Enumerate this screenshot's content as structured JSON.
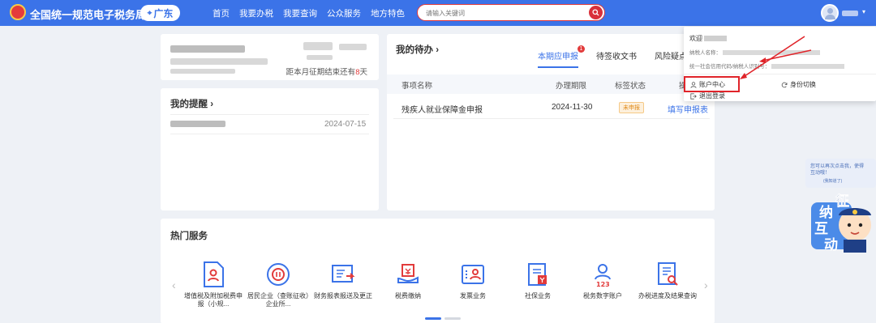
{
  "header": {
    "title": "全国统一规范电子税务局",
    "region": "广东",
    "nav": [
      "首页",
      "我要办税",
      "我要查询",
      "公众服务",
      "地方特色"
    ],
    "search_placeholder": "请输入关键词"
  },
  "profile": {
    "days_prefix": "距本月征期结束还有",
    "days": "8",
    "days_suffix": "天"
  },
  "reminders": {
    "title": "我的提醒",
    "items": [
      {
        "date": "2024-07-15"
      }
    ]
  },
  "todo": {
    "title": "我的待办",
    "tabs": [
      {
        "label": "本期应申报",
        "badge": "1"
      },
      {
        "label": "待签收文书"
      },
      {
        "label": "风险疑点"
      }
    ],
    "columns": [
      "事项名称",
      "办理期限",
      "标签状态",
      "操"
    ],
    "rows": [
      {
        "name": "残疾人就业保障金申报",
        "deadline": "2024-11-30",
        "status": "未申报",
        "action": "填写申报表"
      }
    ]
  },
  "hot": {
    "title": "热门服务",
    "services": [
      {
        "label": "增值税及附加税费申报（小规...",
        "icon": "document-user-icon"
      },
      {
        "label": "居民企业（查账征收）企业所...",
        "icon": "enterprise-income-icon"
      },
      {
        "label": "财务报表报送及更正",
        "icon": "report-icon"
      },
      {
        "label": "税费缴纳",
        "icon": "tax-payment-icon"
      },
      {
        "label": "发票业务",
        "icon": "invoice-icon"
      },
      {
        "label": "社保业务",
        "icon": "social-security-icon"
      },
      {
        "label": "税务数字账户",
        "icon": "digital-account-icon"
      },
      {
        "label": "办税进度及结果查询",
        "icon": "progress-query-icon"
      }
    ]
  },
  "dropdown": {
    "welcome": "欢迎",
    "taxpayer_name_label": "纳税人名称：",
    "credit_code_label": "统一社会信用代码/纳税人识别号：",
    "account_center": "账户中心",
    "switch_identity": "身份切换",
    "logout": "退出登录"
  },
  "chat": {
    "bubble_line1": "您可以再次点击我，使得",
    "bubble_line2": "互动哦！",
    "bubble_hint": "(我知道了)",
    "mascot_text": [
      "征",
      "纳",
      "互",
      "动"
    ]
  },
  "colors": {
    "primary": "#3b73e8",
    "alert": "#e23b3b",
    "warning": "#e08a1a"
  }
}
